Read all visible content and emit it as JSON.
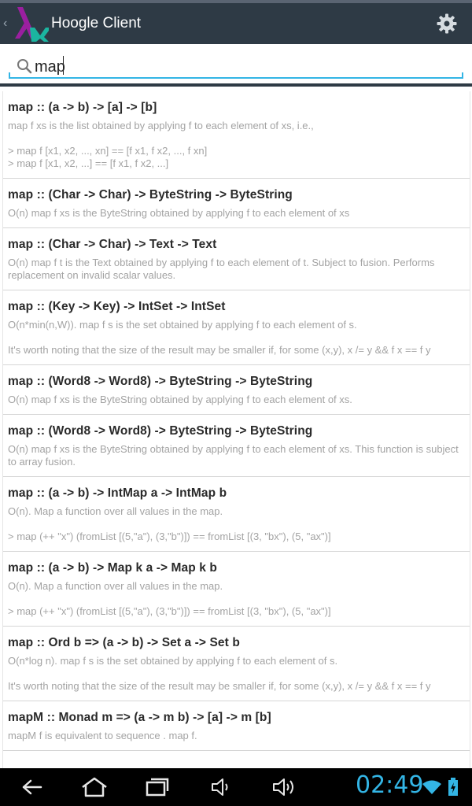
{
  "app": {
    "title": "Hoogle Client"
  },
  "search": {
    "value": "map",
    "placeholder": ""
  },
  "results": [
    {
      "signature": "map :: (a -> b) -> [a] -> [b]",
      "doc": [
        "map f xs is the list obtained by applying f to each element of xs, i.e.,"
      ],
      "examples": [
        "> map f [x1, x2, ..., xn] == [f x1, f x2, ..., f xn]",
        "> map f [x1, x2, ...] == [f x1, f x2, ...]"
      ]
    },
    {
      "signature": "map :: (Char -> Char) -> ByteString -> ByteString",
      "doc": [
        "O(n) map f xs is the ByteString obtained by applying f to each element of xs"
      ],
      "examples": []
    },
    {
      "signature": "map :: (Char -> Char) -> Text -> Text",
      "doc": [
        "O(n) map f t is the Text obtained by applying f to each element of t. Subject to fusion. Performs replacement on invalid scalar values."
      ],
      "examples": []
    },
    {
      "signature": "map :: (Key -> Key) -> IntSet -> IntSet",
      "doc": [
        "O(n*min(n,W)). map f s is the set obtained by applying f to each element of s."
      ],
      "examples": [
        "It's worth noting that the size of the result may be smaller if, for some (x,y), x /= y && f x == f y"
      ]
    },
    {
      "signature": "map :: (Word8 -> Word8) -> ByteString -> ByteString",
      "doc": [
        "O(n) map f xs is the ByteString obtained by applying f to each element of xs."
      ],
      "examples": []
    },
    {
      "signature": "map :: (Word8 -> Word8) -> ByteString -> ByteString",
      "doc": [
        "O(n) map f xs is the ByteString obtained by applying f to each element of xs. This function is subject to array fusion."
      ],
      "examples": []
    },
    {
      "signature": "map :: (a -> b) -> IntMap a -> IntMap b",
      "doc": [
        "O(n). Map a function over all values in the map."
      ],
      "examples": [
        "> map (++ \"x\") (fromList [(5,\"a\"), (3,\"b\")]) == fromList [(3, \"bx\"), (5, \"ax\")]"
      ]
    },
    {
      "signature": "map :: (a -> b) -> Map k a -> Map k b",
      "doc": [
        "O(n). Map a function over all values in the map."
      ],
      "examples": [
        "> map (++ \"x\") (fromList [(5,\"a\"), (3,\"b\")]) == fromList [(3, \"bx\"), (5, \"ax\")]"
      ]
    },
    {
      "signature": "map :: Ord b => (a -> b) -> Set a -> Set b",
      "doc": [
        "O(n*log n). map f s is the set obtained by applying f to each element of s."
      ],
      "examples": [
        "It's worth noting that the size of the result may be smaller if, for some (x,y), x /= y && f x == f y"
      ]
    },
    {
      "signature": "mapM :: Monad m => (a -> m b) -> [a] -> m [b]",
      "doc": [
        "mapM f is equivalent to sequence . map f."
      ],
      "examples": []
    }
  ],
  "navbar": {
    "clock": "02:49"
  },
  "icons": {
    "logo": "hoogle-lambda-logo-icon",
    "settings": "gear-icon",
    "search": "search-icon",
    "back": "back-icon",
    "home": "home-icon",
    "recents": "recent-apps-icon",
    "vol_down": "volume-down-icon",
    "vol_up": "volume-up-icon",
    "wifi": "wifi-icon",
    "battery": "battery-icon"
  },
  "colors": {
    "actionbar": "#2e3a45",
    "accent": "#33b5e5",
    "logo_purple": "#9b1fa0",
    "logo_teal": "#1bb5a0"
  }
}
